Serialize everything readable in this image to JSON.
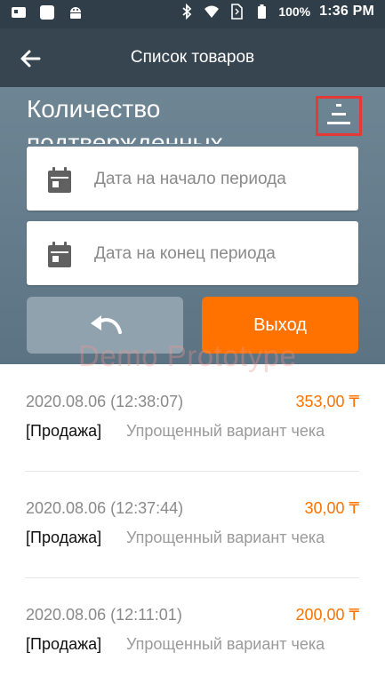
{
  "status_bar": {
    "battery_percent": "100%",
    "time": "1:36 PM",
    "icons": [
      "notification-icon",
      "square-icon",
      "android-icon",
      "bluetooth-icon",
      "wifi-icon",
      "sim-icon",
      "battery-icon"
    ]
  },
  "app_bar": {
    "title": "Список товаров",
    "back_icon": "arrow-left-icon"
  },
  "header": {
    "title_line1": "Количество",
    "title_line2": "подтвержденных",
    "sort_icon": "sort-icon"
  },
  "filters": {
    "start_date_placeholder": "Дата на начало периода",
    "end_date_placeholder": "Дата на конец периода"
  },
  "actions": {
    "undo_icon": "undo-icon",
    "exit_label": "Выход"
  },
  "watermark": "Demo Prototype",
  "transactions": [
    {
      "datetime": "2020.08.06 (12:38:07)",
      "amount": "353,00 ₸",
      "type": "[Продажа]",
      "description": "Упрощенный вариант чека"
    },
    {
      "datetime": "2020.08.06 (12:37:44)",
      "amount": "30,00 ₸",
      "type": "[Продажа]",
      "description": "Упрощенный вариант чека"
    },
    {
      "datetime": "2020.08.06 (12:11:01)",
      "amount": "200,00 ₸",
      "type": "[Продажа]",
      "description": "Упрощенный вариант чека"
    }
  ],
  "colors": {
    "app_bar": "#36454f",
    "header_panel": "#6e8594",
    "accent_orange": "#ff7200",
    "highlight_red": "#e53935"
  }
}
